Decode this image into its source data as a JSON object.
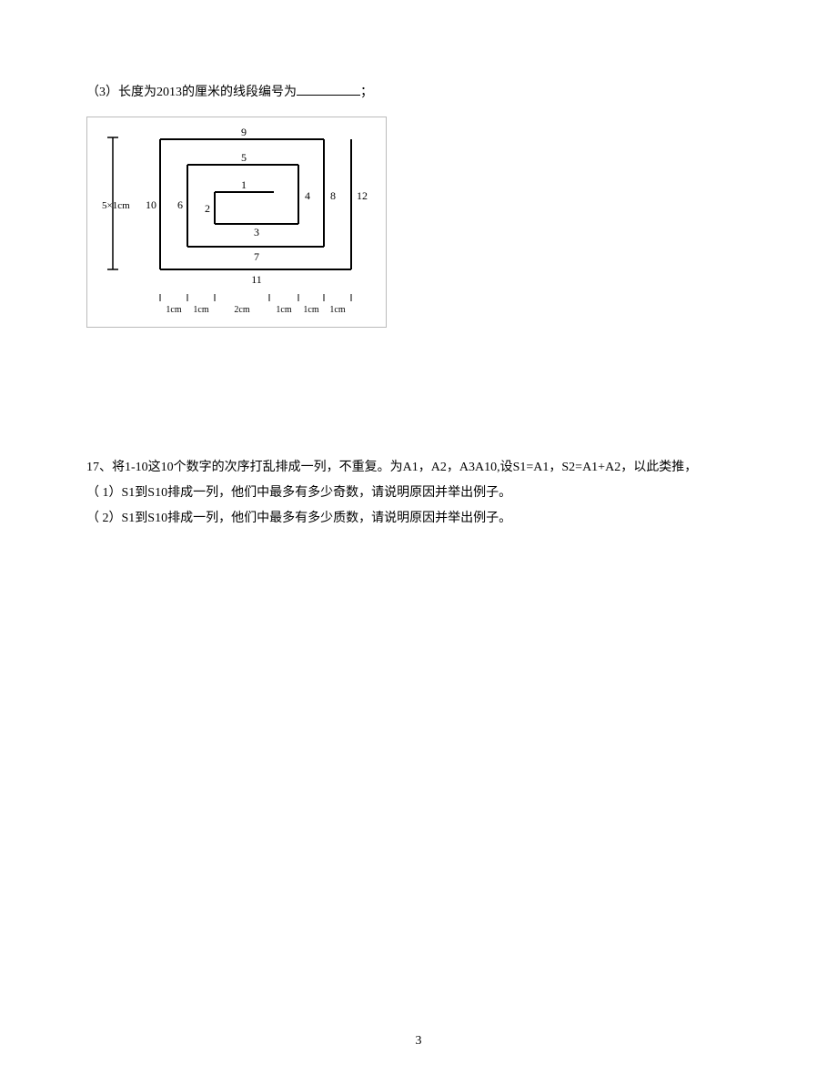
{
  "q3": {
    "prefix": "（3）长度为2013的厘米的线段编号为",
    "suffix": "；"
  },
  "figure": {
    "labels": {
      "n1": "1",
      "n2": "2",
      "n3": "3",
      "n4": "4",
      "n5": "5",
      "n6": "6",
      "n7": "7",
      "n8": "8",
      "n9": "9",
      "n10": "10",
      "n11": "11",
      "n12": "12"
    },
    "vlabel": "5×1cm",
    "xticks": [
      "1cm",
      "1cm",
      "2cm",
      "1cm",
      "1cm",
      "1cm"
    ]
  },
  "q17": {
    "line1": "17、将1-10这10个数字的次序打乱排成一列，不重复。为A1，A2，A3A10,设S1=A1，S2=A1+A2，以此类推，",
    "sub1": "（ 1）S1到S10排成一列，他们中最多有多少奇数，请说明原因并举出例子。",
    "sub2": "（ 2）S1到S10排成一列，他们中最多有多少质数，请说明原因并举出例子。"
  },
  "pagenum": "3"
}
